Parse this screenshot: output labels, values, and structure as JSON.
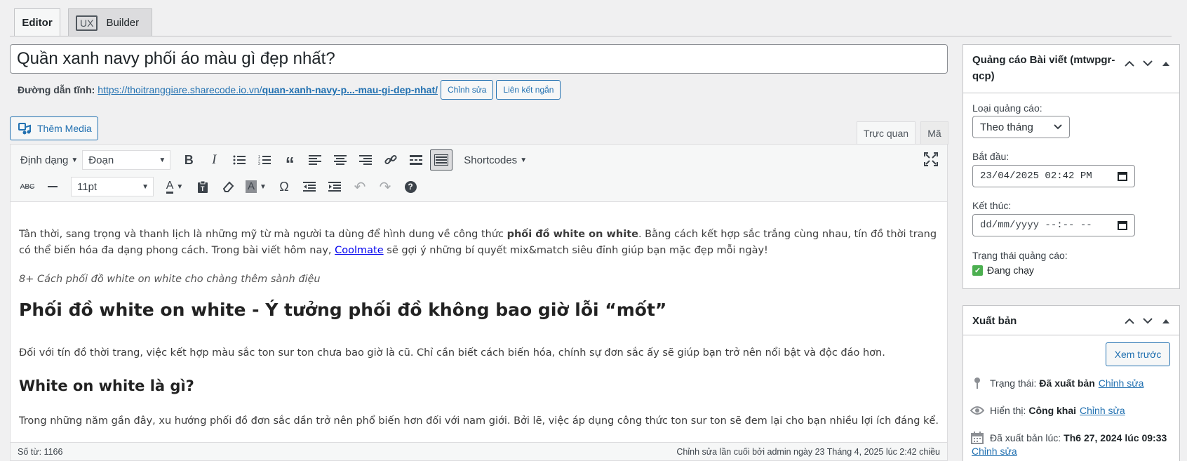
{
  "tabs": {
    "editor": "Editor",
    "ux_badge": "UX",
    "builder": "Builder"
  },
  "post": {
    "title": "Quần xanh navy phối áo màu gì đẹp nhất?"
  },
  "permalink": {
    "label": "Đường dẫn tĩnh:",
    "url_base": "https://thoitranggiare.sharecode.io.vn/",
    "url_slug": "quan-xanh-navy-p...-mau-gi-dep-nhat/",
    "edit_button": "Chỉnh sửa",
    "shortlink_button": "Liên kết ngắn"
  },
  "add_media": "Thêm Media",
  "mode_tabs": {
    "visual": "Trực quan",
    "text": "Mã"
  },
  "toolbar": {
    "format_menu": "Định dạng",
    "paragraph_select": "Đoạn",
    "shortcodes": "Shortcodes",
    "font_size": "11pt"
  },
  "content": {
    "p1_a": "Tân thời, sang trọng và thanh lịch là những mỹ từ mà người ta dùng để hình dung về công thức ",
    "p1_bold": "phối đồ white on white",
    "p1_b": ". Bằng cách kết hợp sắc trắng cùng nhau, tín đồ thời trang có thể biến hóa đa dạng phong cách. Trong bài viết hôm nay, ",
    "p1_link": "Coolmate",
    "p1_c": " sẽ gợi ý những bí quyết mix&match siêu đỉnh giúp bạn mặc đẹp mỗi ngày!",
    "caption": "8+ Cách phối đồ white on white cho chàng thêm sành điệu",
    "h2": "Phối đồ white on white - Ý tưởng phối đồ không bao giờ lỗi “mốt”",
    "p3": "Đối với tín đồ thời trang, việc kết hợp màu sắc ton sur ton chưa bao giờ là cũ. Chỉ cần biết cách biến hóa, chính sự đơn sắc ấy sẽ giúp bạn trở nên nổi bật và độc đáo hơn.",
    "h3": "White on white là gì?",
    "p4": "Trong những năm gần đây, xu hướng phối đồ đơn sắc dần trở nên phổ biến hơn đối với nam giới. Bởi lẽ, việc áp dụng công thức ton sur ton sẽ đem lại cho bạn nhiều lợi ích đáng kể."
  },
  "status_bar": {
    "word_count": "Số từ: 1166",
    "last_edit": "Chỉnh sửa lần cuối bởi admin ngày 23 Tháng 4, 2025 lúc 2:42 chiều"
  },
  "ad_box": {
    "title": "Quảng cáo Bài viết (mtwpgr-qcp)",
    "type_label": "Loại quảng cáo:",
    "type_value": "Theo tháng",
    "start_label": "Bắt đầu:",
    "start_value": "23/04/2025 02:42 PM",
    "end_label": "Kết thúc:",
    "end_placeholder": "dd/mm/yyyy --:-- --",
    "status_label": "Trạng thái quảng cáo:",
    "status_value": "Đang chạy"
  },
  "publish_box": {
    "title": "Xuất bản",
    "preview_button": "Xem trước",
    "status_label": "Trạng thái:",
    "status_value": "Đã xuất bản",
    "visibility_label": "Hiển thị:",
    "visibility_value": "Công khai",
    "published_label": "Đã xuất bản lúc:",
    "published_value": "Th6 27, 2024 lúc 09:33",
    "edit_link": "Chỉnh sửa"
  },
  "colors": {
    "accent": "#2271b1",
    "border": "#c3c4c7",
    "background": "#f0f0f1"
  }
}
